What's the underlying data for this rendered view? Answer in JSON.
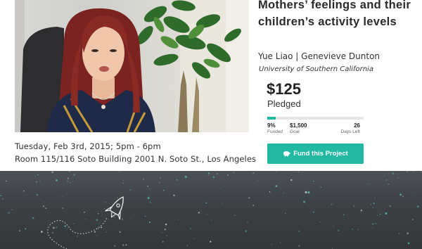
{
  "project": {
    "title": "Mothers’ feelings and their children’s activity levels",
    "authors": "Yue Liao | Genevieve Dunton",
    "affiliation": "University of Southern California"
  },
  "funding": {
    "amount": "$125",
    "amount_label": "Pledged",
    "progress_fraction": 0.09,
    "funded_value": "9%",
    "funded_label": "Funded",
    "goal_value": "$1,500",
    "goal_label": "Goal",
    "days_value": "26",
    "days_label": "Days Left"
  },
  "cta": {
    "label": "Fund this Project",
    "icon": "piggy-bank-icon",
    "color": "#22b8a1"
  },
  "event": {
    "date": "Tuesday, Feb 3rd, 2015; 5pm - 6pm",
    "location": "Room 115/116 Soto Building 2001 N. Soto St., Los Angeles"
  },
  "video": {
    "thumbnail": "researcher-speaking-thumbnail"
  },
  "banner": {
    "icon": "rocket-icon"
  }
}
